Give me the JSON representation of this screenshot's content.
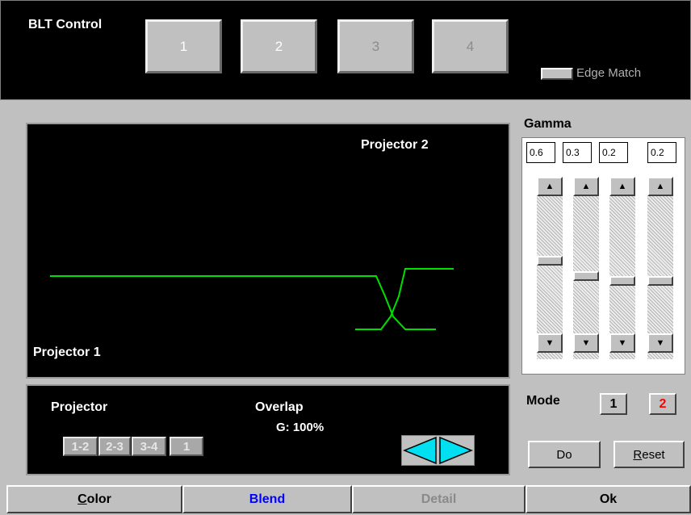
{
  "app": {
    "title": "BLT Control"
  },
  "projector_buttons": [
    {
      "label": "1"
    },
    {
      "label": "2"
    },
    {
      "label": "3"
    },
    {
      "label": "4"
    }
  ],
  "edge_match": {
    "label": "Edge Match"
  },
  "display": {
    "projector2_label": "Projector 2",
    "projector1_label": "Projector 1"
  },
  "projector_panel": {
    "title": "Projector",
    "pairs": [
      "1-2",
      "2-3",
      "3-4",
      "1"
    ]
  },
  "overlap": {
    "title": "Overlap",
    "value": "G: 100%"
  },
  "gamma": {
    "title": "Gamma",
    "values": [
      "0.6",
      "0.3",
      "0.2",
      "0.2"
    ]
  },
  "mode": {
    "label": "Mode",
    "options": [
      "1",
      "2"
    ],
    "active": "2",
    "active_color": "#ff0000"
  },
  "actions": {
    "do_label": "Do",
    "reset_label": "Reset"
  },
  "tabs": [
    {
      "label": "Color",
      "accel": "C"
    },
    {
      "label": "Blend",
      "color": "#0000ff"
    },
    {
      "label": "Detail",
      "disabled": true
    },
    {
      "label": "Ok"
    }
  ],
  "colors": {
    "curve": "#00e000",
    "arrow_fill": "#00e0f0"
  }
}
